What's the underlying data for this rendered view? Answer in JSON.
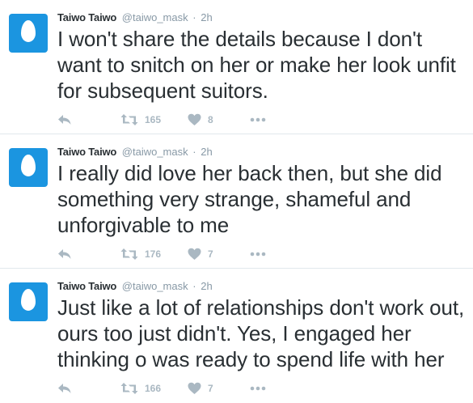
{
  "colors": {
    "avatar_bg": "#1b95e0",
    "text": "#292f33",
    "muted": "#8899a6",
    "action_icon": "#aab8c2",
    "divider": "#e1e8ed"
  },
  "tweets": [
    {
      "fullname": "Taiwo Taiwo",
      "username": "@taiwo_mask",
      "separator": "·",
      "time": "2h",
      "text": "I won't share the details because I don't want to snitch on her or make her look unfit for subsequent suitors.",
      "retweets": "165",
      "likes": "8",
      "icons": [
        "reply-icon",
        "retweet-icon",
        "like-icon",
        "more-icon"
      ]
    },
    {
      "fullname": "Taiwo Taiwo",
      "username": "@taiwo_mask",
      "separator": "·",
      "time": "2h",
      "text": "I really did love her back then, but she did something very strange, shameful and unforgivable to me",
      "retweets": "176",
      "likes": "7",
      "icons": [
        "reply-icon",
        "retweet-icon",
        "like-icon",
        "more-icon"
      ]
    },
    {
      "fullname": "Taiwo Taiwo",
      "username": "@taiwo_mask",
      "separator": "·",
      "time": "2h",
      "text": "Just like a lot of relationships don't work out, ours too just didn't. Yes, I engaged her thinking o was ready to spend life with her",
      "retweets": "166",
      "likes": "7",
      "icons": [
        "reply-icon",
        "retweet-icon",
        "like-icon",
        "more-icon"
      ]
    }
  ]
}
